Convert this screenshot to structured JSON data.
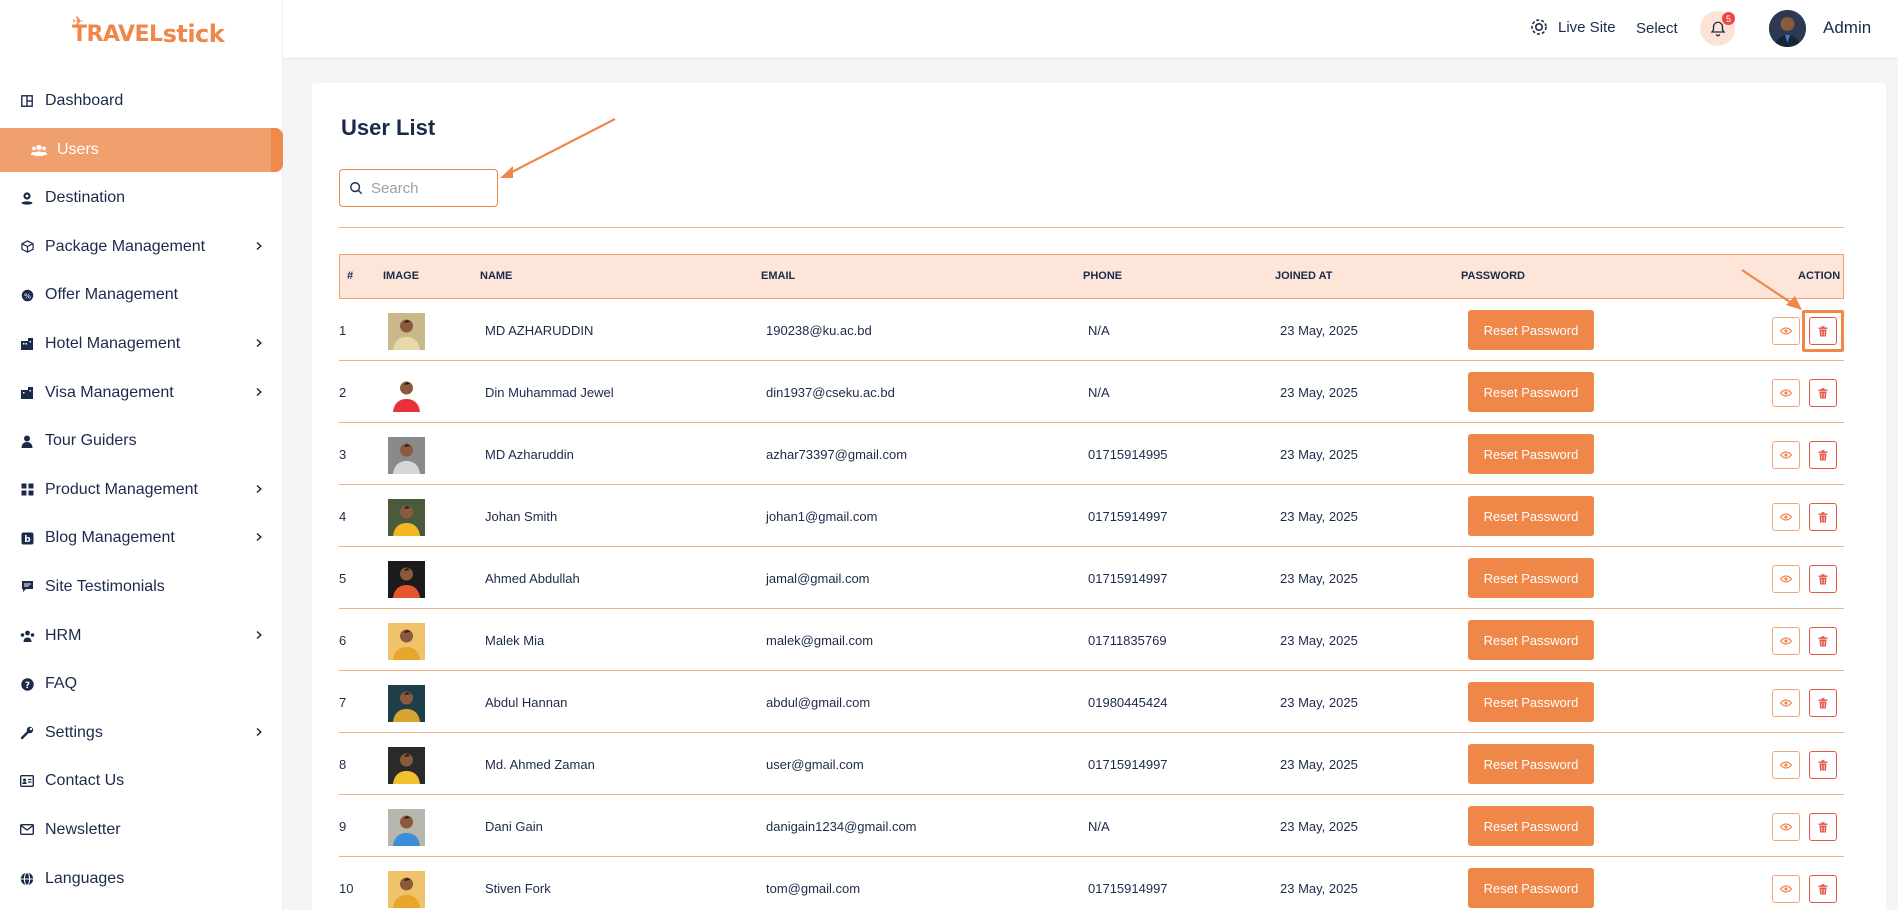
{
  "brand": {
    "logo_text": "TRAVEL",
    "logo_text2": "stick"
  },
  "sidebar": {
    "items": [
      {
        "label": "Dashboard",
        "icon": "dashboard-icon",
        "has_children": false,
        "active": false
      },
      {
        "label": "Users",
        "icon": "users-icon",
        "has_children": false,
        "active": true
      },
      {
        "label": "Destination",
        "icon": "destination-icon",
        "has_children": false,
        "active": false
      },
      {
        "label": "Package Management",
        "icon": "package-icon",
        "has_children": true,
        "active": false
      },
      {
        "label": "Offer Management",
        "icon": "offer-icon",
        "has_children": false,
        "active": false
      },
      {
        "label": "Hotel Management",
        "icon": "hotel-icon",
        "has_children": true,
        "active": false
      },
      {
        "label": "Visa Management",
        "icon": "visa-icon",
        "has_children": true,
        "active": false
      },
      {
        "label": "Tour Guiders",
        "icon": "guide-icon",
        "has_children": false,
        "active": false
      },
      {
        "label": "Product Management",
        "icon": "product-icon",
        "has_children": true,
        "active": false
      },
      {
        "label": "Blog Management",
        "icon": "blog-icon",
        "has_children": true,
        "active": false
      },
      {
        "label": "Site Testimonials",
        "icon": "testimonial-icon",
        "has_children": false,
        "active": false
      },
      {
        "label": "HRM",
        "icon": "hrm-icon",
        "has_children": true,
        "active": false
      },
      {
        "label": "FAQ",
        "icon": "faq-icon",
        "has_children": false,
        "active": false
      },
      {
        "label": "Settings",
        "icon": "settings-icon",
        "has_children": true,
        "active": false
      },
      {
        "label": "Contact Us",
        "icon": "contact-icon",
        "has_children": false,
        "active": false
      },
      {
        "label": "Newsletter",
        "icon": "newsletter-icon",
        "has_children": false,
        "active": false
      },
      {
        "label": "Languages",
        "icon": "globe-icon",
        "has_children": false,
        "active": false
      }
    ]
  },
  "topbar": {
    "live_site": "Live Site",
    "select": "Select",
    "notification_count": "5",
    "user_name": "Admin"
  },
  "page": {
    "title": "User List",
    "search_placeholder": "Search"
  },
  "table": {
    "headers": [
      "#",
      "IMAGE",
      "NAME",
      "EMAIL",
      "PHONE",
      "JOINED AT",
      "PASSWORD",
      "ACTION"
    ],
    "reset_label": "Reset Password",
    "rows": [
      {
        "num": "1",
        "name": "MD AZHARUDDIN",
        "email": "190238@ku.ac.bd",
        "phone": "N/A",
        "joined": "23 May, 2025",
        "avatar_color": "#c9b88a",
        "shirt_color": "#e9d9a8"
      },
      {
        "num": "2",
        "name": "Din Muhammad Jewel",
        "email": "din1937@cseku.ac.bd",
        "phone": "N/A",
        "joined": "23 May, 2025",
        "avatar_color": "#ffffff",
        "shirt_color": "#e8313a"
      },
      {
        "num": "3",
        "name": "MD Azharuddin",
        "email": "azhar73397@gmail.com",
        "phone": "01715914995",
        "joined": "23 May, 2025",
        "avatar_color": "#8a8a8a",
        "shirt_color": "#d6d6d6"
      },
      {
        "num": "4",
        "name": "Johan Smith",
        "email": "johan1@gmail.com",
        "phone": "01715914997",
        "joined": "23 May, 2025",
        "avatar_color": "#4b5a3a",
        "shirt_color": "#f2b722"
      },
      {
        "num": "5",
        "name": "Ahmed Abdullah",
        "email": "jamal@gmail.com",
        "phone": "01715914997",
        "joined": "23 May, 2025",
        "avatar_color": "#1b1b1b",
        "shirt_color": "#e4572e"
      },
      {
        "num": "6",
        "name": "Malek Mia",
        "email": "malek@gmail.com",
        "phone": "01711835769",
        "joined": "23 May, 2025",
        "avatar_color": "#f0c36b",
        "shirt_color": "#e7a52b"
      },
      {
        "num": "7",
        "name": "Abdul Hannan",
        "email": "abdul@gmail.com",
        "phone": "01980445424",
        "joined": "23 May, 2025",
        "avatar_color": "#1e3e4a",
        "shirt_color": "#d9a431"
      },
      {
        "num": "8",
        "name": "Md. Ahmed Zaman",
        "email": "user@gmail.com",
        "phone": "01715914997",
        "joined": "23 May, 2025",
        "avatar_color": "#2a2a2a",
        "shirt_color": "#f2c12e"
      },
      {
        "num": "9",
        "name": "Dani Gain",
        "email": "danigain1234@gmail.com",
        "phone": "N/A",
        "joined": "23 May, 2025",
        "avatar_color": "#b7b7b0",
        "shirt_color": "#3b8fd6"
      },
      {
        "num": "10",
        "name": "Stiven Fork",
        "email": "tom@gmail.com",
        "phone": "01715914997",
        "joined": "23 May, 2025",
        "avatar_color": "#f0c36b",
        "shirt_color": "#e7a52b"
      }
    ]
  },
  "colors": {
    "accent": "#ef8748",
    "danger": "#e2574c",
    "header_bg": "#fde5d9"
  }
}
